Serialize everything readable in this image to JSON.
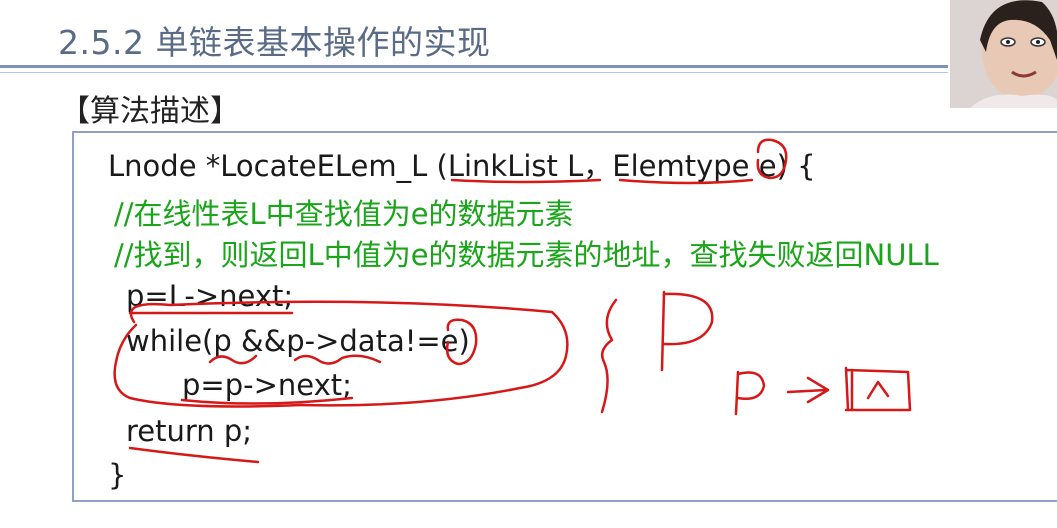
{
  "slide": {
    "title": "2.5.2 单链表基本操作的实现",
    "section_label": "【算法描述】"
  },
  "code": {
    "lines": [
      "Lnode *LocateELem_L (LinkList L，Elemtype e) {",
      "//在线性表L中查找值为e的数据元素",
      "//找到，则返回L中值为e的数据元素的地址，查找失败返回NULL",
      "p=L->next;",
      "while(p &&p->data!=e)",
      "p=p->next;",
      "return p;",
      "}"
    ]
  },
  "colors": {
    "title": "#5a6b86",
    "rule": "#7d92b8",
    "box_border": "#8fa2c4",
    "comment": "#1aa51a",
    "annotation_ink": "#d61818"
  }
}
